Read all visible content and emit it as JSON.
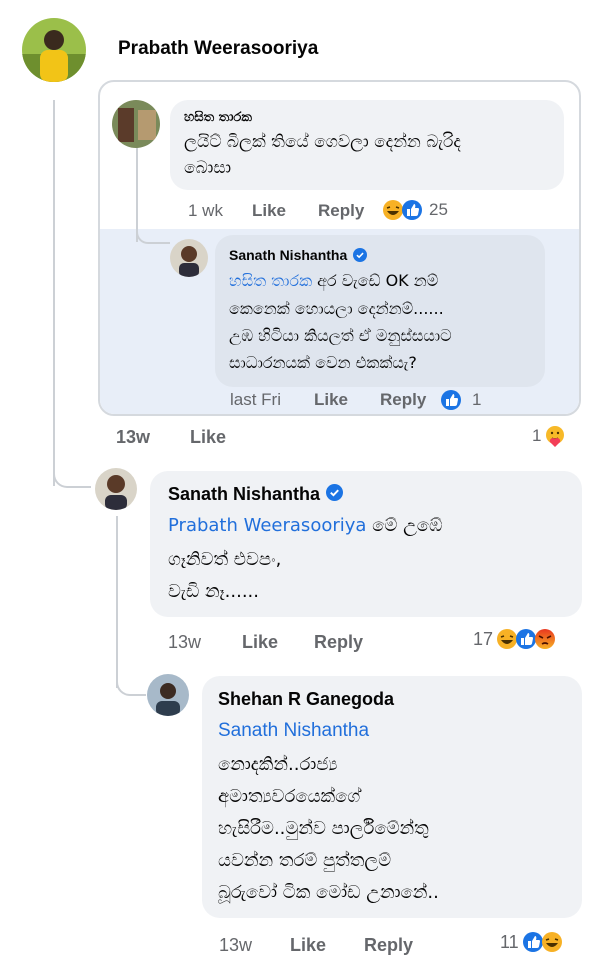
{
  "root": {
    "author": "Prabath Weerasooriya",
    "quoted": {
      "comment": {
        "author": "හසිත තාරක",
        "text_line1": "ලයිට් බිලක් තියේ ගෙවලා දෙන්න බැරිද",
        "text_line2": "බොසා",
        "time": "1 wk",
        "like": "Like",
        "reply": "Reply",
        "reaction_count": "25"
      },
      "reply": {
        "author": "Sanath Nishantha",
        "mention": "හසිත තාරක",
        "text_line1_rest": " අර වැඩේ OK නම්",
        "text_line2": "කෙනෙක් හොයලා දෙන්නම්......",
        "text_line3": "උඹ හිටියා කියලත් ඒ මනුස්සයාට",
        "text_line4": "සාධාරනයක් වෙන එකක්යැ?",
        "time": "last Fri",
        "like": "Like",
        "reply": "Reply",
        "reaction_count": "1"
      }
    },
    "time": "13w",
    "like": "Like",
    "reaction_count": "1"
  },
  "reply1": {
    "author": "Sanath Nishantha",
    "mention": "Prabath Weerasooriya",
    "text_line1_rest": " මේ උඹේ",
    "text_line2": "ගෑනිවත් එවපං,",
    "text_line3": "වැඩි නෑ......",
    "time": "13w",
    "like": "Like",
    "reply": "Reply",
    "reaction_count": "17"
  },
  "reply2": {
    "author": "Shehan R Ganegoda",
    "mention": "Sanath Nishantha",
    "text_line2": "නොදකින්..රාජ්‍ය",
    "text_line3": "අමාත්‍යවරයෙක්ගේ",
    "text_line4": "හැසිරීම..මුන්ව පාර්ලිමේන්තු",
    "text_line5": "යවන්න තරම් පුත්තලම්",
    "text_line6": "බූරුවෝ ටික මෝඩ උනානේ..",
    "time": "13w",
    "like": "Like",
    "reply": "Reply",
    "reaction_count": "11"
  },
  "colors": {
    "mention": "#216fdb",
    "like_blue": "#1b74e4",
    "haha_yellow": "#f7b125",
    "angry_orange": "#e9710f",
    "care": "#f7b928"
  },
  "icons": [
    "verified-badge-icon",
    "like-reaction-icon",
    "haha-reaction-icon",
    "angry-reaction-icon",
    "care-reaction-icon"
  ]
}
